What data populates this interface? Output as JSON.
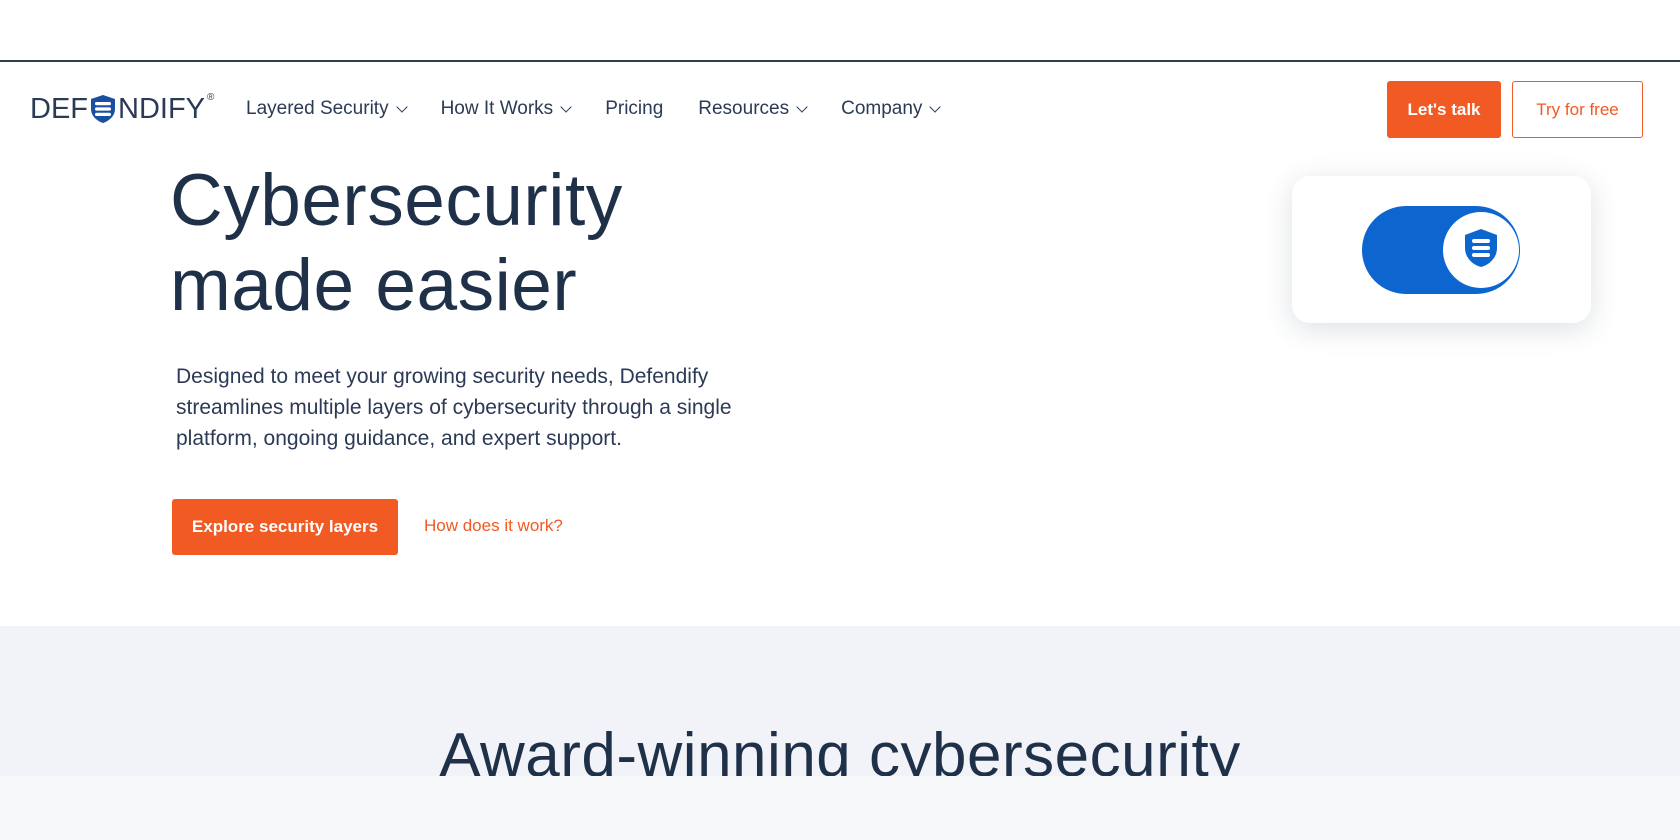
{
  "brand": {
    "logo_text_left": "DEF",
    "logo_text_right": "NDIFY",
    "logo_mark": "®"
  },
  "nav": {
    "items": [
      {
        "label": "Layered Security",
        "has_dropdown": true
      },
      {
        "label": "How It Works",
        "has_dropdown": true
      },
      {
        "label": "Pricing",
        "has_dropdown": false
      },
      {
        "label": "Resources",
        "has_dropdown": true
      },
      {
        "label": "Company",
        "has_dropdown": true
      }
    ]
  },
  "header_actions": {
    "talk_label": "Let's talk",
    "try_label": "Try for free"
  },
  "hero": {
    "title_line1": "Cybersecurity",
    "title_line2": "made easier",
    "description": "Designed to meet your growing security needs, Defendify streamlines multiple layers of cybersecurity through a single platform, ongoing guidance, and expert support.",
    "primary_cta": "Explore security layers",
    "secondary_cta": "How does it work?",
    "toggle_state": "on"
  },
  "awards": {
    "heading": "Award-winning cybersecurity"
  },
  "colors": {
    "accent": "#f15a22",
    "navy": "#1f3049",
    "toggle_blue": "#0d66d0",
    "band_bg": "#f1f3f8"
  },
  "icons": {
    "logo": "shield-logo-icon",
    "toggle_knob": "shield-icon",
    "nav_dropdown": "chevron-down-icon"
  }
}
